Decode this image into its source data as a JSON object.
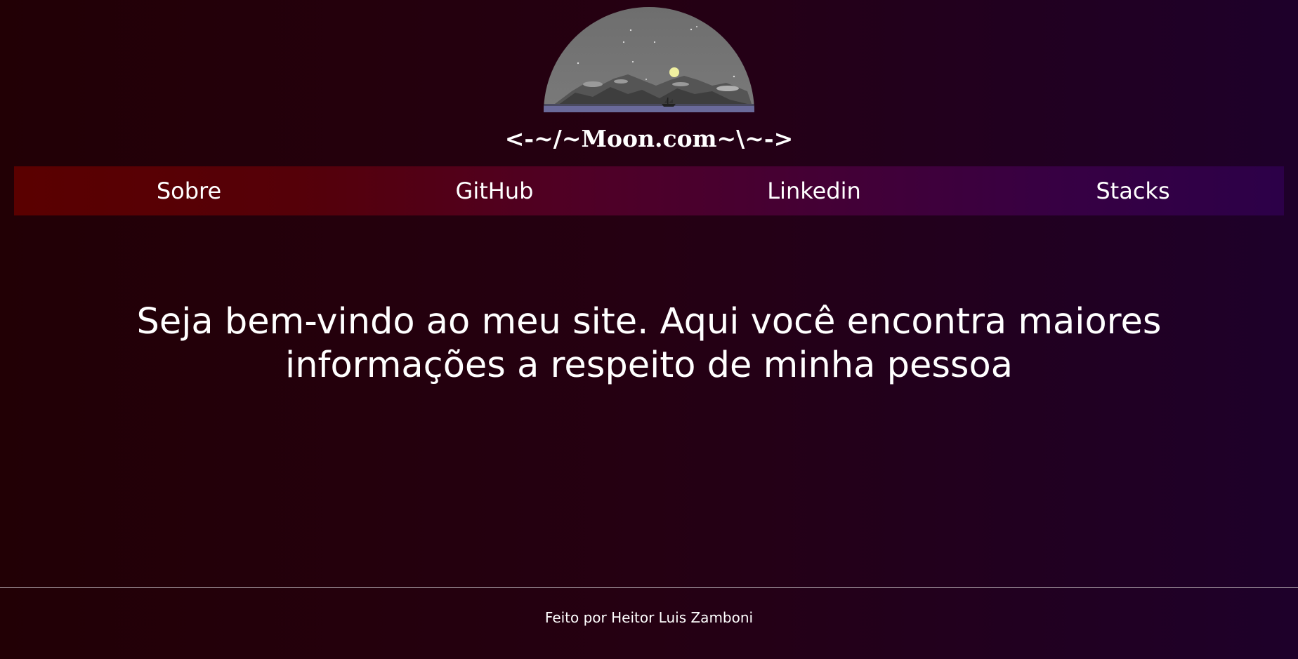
{
  "header": {
    "logo_icon": "moon-night-landscape-logo",
    "title": "<-~/~Moon.com~\\~->"
  },
  "nav": {
    "items": [
      {
        "label": "Sobre"
      },
      {
        "label": "GitHub"
      },
      {
        "label": "Linkedin"
      },
      {
        "label": "Stacks"
      }
    ]
  },
  "main": {
    "welcome_line1": "Seja bem-vindo ao meu site. Aqui você encontra maiores",
    "welcome_line2": "informações a respeito de minha pessoa"
  },
  "footer": {
    "text": "Feito por Heitor Luis Zamboni"
  },
  "colors": {
    "background_left": "#220005",
    "background_right": "#1e002a",
    "nav_left": "#5a0000",
    "nav_right": "#2c0048",
    "text": "#ffffff",
    "moon": "#f0f0a0"
  }
}
